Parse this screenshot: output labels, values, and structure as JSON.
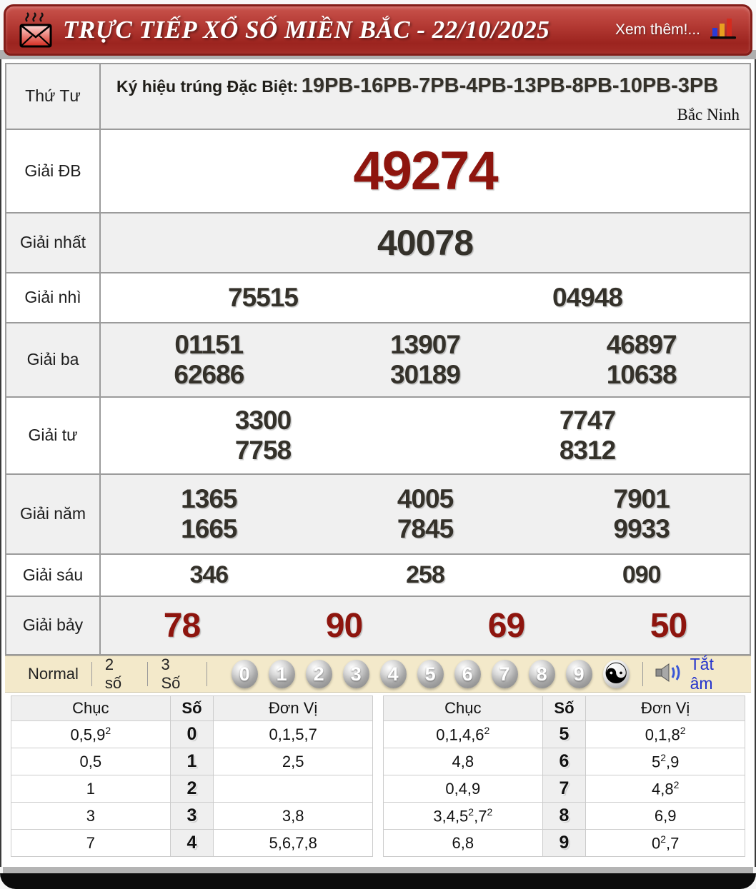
{
  "header": {
    "title": "TRỰC TIẾP XỔ SỐ MIỀN BẮC - 22/10/2025",
    "more": "Xem thêm!...",
    "mail_icon": "mail-icon",
    "chart_icon": "bar-chart-icon"
  },
  "info": {
    "day": "Thứ Tư",
    "symbol_label": "Ký hiệu trúng Đặc Biệt:",
    "symbol_value": "19PB-16PB-7PB-4PB-13PB-8PB-10PB-3PB",
    "province": "Bắc Ninh"
  },
  "prizes": [
    {
      "label": "Giải ĐB",
      "lines": [
        [
          "49274"
        ]
      ]
    },
    {
      "label": "Giải nhất",
      "lines": [
        [
          "40078"
        ]
      ]
    },
    {
      "label": "Giải nhì",
      "lines": [
        [
          "75515",
          "04948"
        ]
      ]
    },
    {
      "label": "Giải ba",
      "lines": [
        [
          "01151",
          "13907",
          "46897"
        ],
        [
          "62686",
          "30189",
          "10638"
        ]
      ]
    },
    {
      "label": "Giải tư",
      "lines": [
        [
          "3300",
          "7747"
        ],
        [
          "7758",
          "8312"
        ]
      ]
    },
    {
      "label": "Giải năm",
      "lines": [
        [
          "1365",
          "4005",
          "7901"
        ],
        [
          "1665",
          "7845",
          "9933"
        ]
      ]
    },
    {
      "label": "Giải sáu",
      "lines": [
        [
          "346",
          "258",
          "090"
        ]
      ]
    },
    {
      "label": "Giải bảy",
      "lines": [
        [
          "78",
          "90",
          "69",
          "50"
        ]
      ]
    }
  ],
  "controls": {
    "modes": [
      "Normal",
      "2 số",
      "3 Số"
    ],
    "balls": [
      "0",
      "1",
      "2",
      "3",
      "4",
      "5",
      "6",
      "7",
      "8",
      "9"
    ],
    "yinyang_glyph": "☯",
    "speaker_icon": "speaker-icon",
    "mute_label": "Tắt âm"
  },
  "stats": {
    "headers": {
      "tens": "Chục",
      "digit": "Số",
      "units": "Đơn Vị"
    },
    "left": [
      {
        "tens": "0,5,9^2",
        "digit": "0",
        "units": "0,1,5,7"
      },
      {
        "tens": "0,5",
        "digit": "1",
        "units": "2,5"
      },
      {
        "tens": "1",
        "digit": "2",
        "units": ""
      },
      {
        "tens": "3",
        "digit": "3",
        "units": "3,8"
      },
      {
        "tens": "7",
        "digit": "4",
        "units": "5,6,7,8"
      }
    ],
    "right": [
      {
        "tens": "0,1,4,6^2",
        "digit": "5",
        "units": "0,1,8^2"
      },
      {
        "tens": "4,8",
        "digit": "6",
        "units": "5^2,9"
      },
      {
        "tens": "0,4,9",
        "digit": "7",
        "units": "4,8^2"
      },
      {
        "tens": "3,4,5^2,7^2",
        "digit": "8",
        "units": "6,9"
      },
      {
        "tens": "6,8",
        "digit": "9",
        "units": "0^2,7"
      }
    ]
  },
  "colors": {
    "header_red": "#a82a25",
    "special_number_red": "#8e150e",
    "number_dark": "#34312a",
    "mute_blue": "#2433cc",
    "control_bar_beige": "#f3e9ca",
    "row_shade": "#f0f0f0"
  }
}
